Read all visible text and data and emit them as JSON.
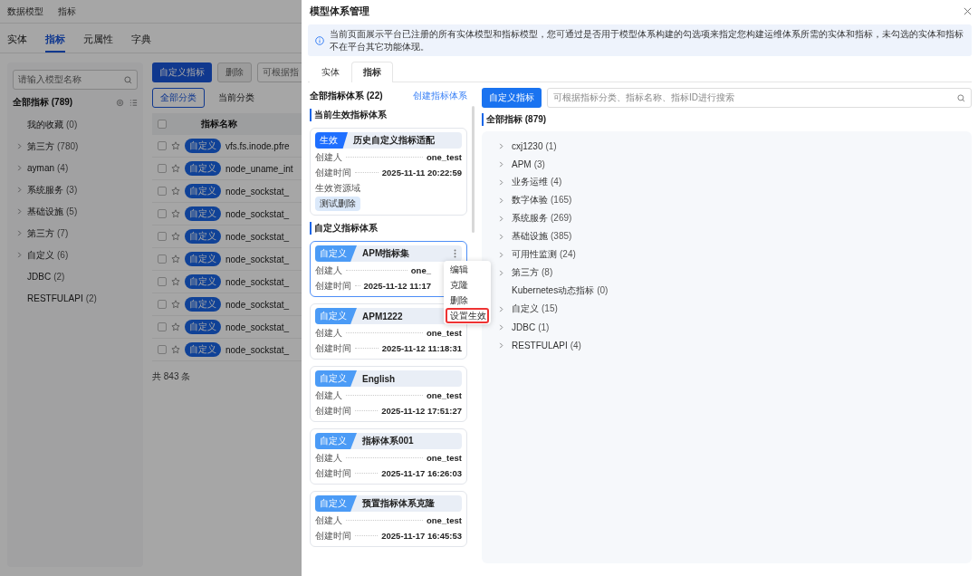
{
  "background": {
    "breadcrumb": [
      "数据模型",
      "指标"
    ],
    "tabs": [
      {
        "label": "实体",
        "selected": false
      },
      {
        "label": "指标",
        "selected": true
      },
      {
        "label": "元属性",
        "selected": false
      },
      {
        "label": "字典",
        "selected": false
      }
    ],
    "tree": {
      "search_placeholder": "请输入模型名称",
      "title": "全部指标 (789)",
      "items": [
        {
          "label": "我的收藏",
          "count": "(0)",
          "expandable": false
        },
        {
          "label": "第三方",
          "count": "(780)",
          "expandable": true
        },
        {
          "label": "ayman",
          "count": "(4)",
          "expandable": true
        },
        {
          "label": "系统服务",
          "count": "(3)",
          "expandable": true
        },
        {
          "label": "基础设施",
          "count": "(5)",
          "expandable": true
        },
        {
          "label": "第三方",
          "count": "(7)",
          "expandable": true
        },
        {
          "label": "自定义",
          "count": "(6)",
          "expandable": true
        },
        {
          "label": "JDBC",
          "count": "(2)",
          "expandable": false
        },
        {
          "label": "RESTFULAPI",
          "count": "(2)",
          "expandable": false
        }
      ]
    },
    "toolbar": {
      "primary": "自定义指标",
      "secondary": "删除",
      "search_placeholder": "可根据指"
    },
    "segments": [
      {
        "label": "全部分类",
        "selected": true
      },
      {
        "label": "当前分类",
        "selected": false
      }
    ],
    "table": {
      "columns": [
        "指标名称"
      ],
      "all_checked": false,
      "rows": [
        {
          "checked": false,
          "tag": "自定义",
          "name": "vfs.fs.inode.pfre"
        },
        {
          "checked": false,
          "tag": "自定义",
          "name": "node_uname_int"
        },
        {
          "checked": false,
          "tag": "自定义",
          "name": "node_sockstat_"
        },
        {
          "checked": false,
          "tag": "自定义",
          "name": "node_sockstat_"
        },
        {
          "checked": false,
          "tag": "自定义",
          "name": "node_sockstat_"
        },
        {
          "checked": false,
          "tag": "自定义",
          "name": "node_sockstat_"
        },
        {
          "checked": false,
          "tag": "自定义",
          "name": "node_sockstat_"
        },
        {
          "checked": false,
          "tag": "自定义",
          "name": "node_sockstat_"
        },
        {
          "checked": false,
          "tag": "自定义",
          "name": "node_sockstat_"
        },
        {
          "checked": false,
          "tag": "自定义",
          "name": "node_sockstat_"
        }
      ]
    },
    "total": "共 843 条"
  },
  "modal": {
    "title": "模型体系管理",
    "info": "当前页面展示平台已注册的所有实体模型和指标模型，您可通过是否用于模型体系构建的勾选项来指定您构建运维体系所需的实体和指标，未勾选的实体和指标不在平台其它功能体现。",
    "tabs": [
      {
        "label": "实体",
        "selected": false
      },
      {
        "label": "指标",
        "selected": true
      }
    ],
    "systems": {
      "title": "全部指标体系 (22)",
      "create_link": "创建指标体系",
      "sections": [
        {
          "heading": "当前生效指标体系",
          "cards": [
            {
              "kind": "active",
              "tag": "生效",
              "name": "历史自定义指标适配",
              "selected": false,
              "creator_label": "创建人",
              "creator": "one_test",
              "time_label": "创建时间",
              "time": "2025-11-11 20:22:59",
              "domain_label": "生效资源域",
              "domains": [
                "测试删除"
              ]
            }
          ]
        },
        {
          "heading": "自定义指标体系",
          "cards": [
            {
              "kind": "custom",
              "tag": "自定义",
              "name": "APM指标集",
              "selected": true,
              "creator_label": "创建人",
              "creator": "one_",
              "time_label": "创建时间",
              "time": "2025-11-12 11:17",
              "menu": [
                {
                  "label": "编辑",
                  "highlighted": false
                },
                {
                  "label": "克隆",
                  "highlighted": false
                },
                {
                  "label": "删除",
                  "highlighted": false
                },
                {
                  "label": "设置生效",
                  "highlighted": true
                }
              ]
            },
            {
              "kind": "custom",
              "tag": "自定义",
              "name": "APM1222",
              "selected": false,
              "creator_label": "创建人",
              "creator": "one_test",
              "time_label": "创建时间",
              "time": "2025-11-12 11:18:31"
            },
            {
              "kind": "custom",
              "tag": "自定义",
              "name": "English",
              "selected": false,
              "creator_label": "创建人",
              "creator": "one_test",
              "time_label": "创建时间",
              "time": "2025-11-12 17:51:27"
            },
            {
              "kind": "custom",
              "tag": "自定义",
              "name": "指标体系001",
              "selected": false,
              "creator_label": "创建人",
              "creator": "one_test",
              "time_label": "创建时间",
              "time": "2025-11-17 16:26:03"
            },
            {
              "kind": "custom",
              "tag": "自定义",
              "name": "预置指标体系克隆",
              "selected": false,
              "creator_label": "创建人",
              "creator": "one_test",
              "time_label": "创建时间",
              "time": "2025-11-17 16:45:53"
            }
          ]
        }
      ]
    },
    "metrics": {
      "button": "自定义指标",
      "search_placeholder": "可根据指标分类、指标名称、指标ID进行搜索",
      "title": "全部指标 (879)",
      "items": [
        {
          "label": "cxj1230",
          "count": "(1)",
          "expandable": true
        },
        {
          "label": "APM",
          "count": "(3)",
          "expandable": true
        },
        {
          "label": "业务运维",
          "count": "(4)",
          "expandable": true
        },
        {
          "label": "数字体验",
          "count": "(165)",
          "expandable": true
        },
        {
          "label": "系统服务",
          "count": "(269)",
          "expandable": true
        },
        {
          "label": "基础设施",
          "count": "(385)",
          "expandable": true
        },
        {
          "label": "可用性监测",
          "count": "(24)",
          "expandable": true
        },
        {
          "label": "第三方",
          "count": "(8)",
          "expandable": true
        },
        {
          "label": "Kubernetes动态指标",
          "count": "(0)",
          "expandable": false
        },
        {
          "label": "自定义",
          "count": "(15)",
          "expandable": true
        },
        {
          "label": "JDBC",
          "count": "(1)",
          "expandable": true
        },
        {
          "label": "RESTFULAPI",
          "count": "(4)",
          "expandable": true
        }
      ]
    }
  }
}
